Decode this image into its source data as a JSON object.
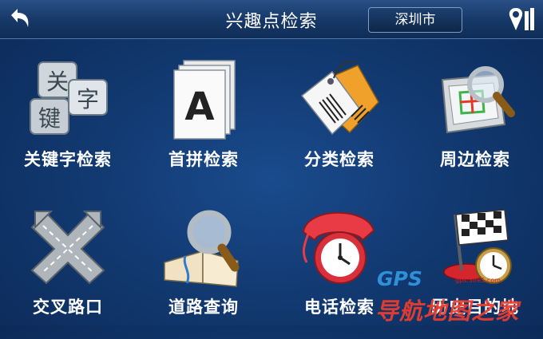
{
  "header": {
    "title": "兴趣点检索",
    "city": "深圳市"
  },
  "tiles": [
    {
      "label": "关键字检索",
      "icon": "keyword-keys-icon",
      "keys": [
        "关",
        "字",
        "键"
      ]
    },
    {
      "label": "首拼检索",
      "icon": "initial-letter-pages-icon",
      "letter": "A"
    },
    {
      "label": "分类检索",
      "icon": "category-tags-icon"
    },
    {
      "label": "周边检索",
      "icon": "nearby-map-magnifier-icon"
    },
    {
      "label": "交叉路口",
      "icon": "intersection-arrows-icon"
    },
    {
      "label": "道路查询",
      "icon": "road-book-magnifier-icon"
    },
    {
      "label": "电话检索",
      "icon": "phone-clock-icon"
    },
    {
      "label": "历史目的地",
      "icon": "checkered-flag-clock-icon"
    }
  ],
  "watermark": {
    "gps": "GPS",
    "site": "gps.5ire5.com",
    "name": "导航地图之家"
  }
}
